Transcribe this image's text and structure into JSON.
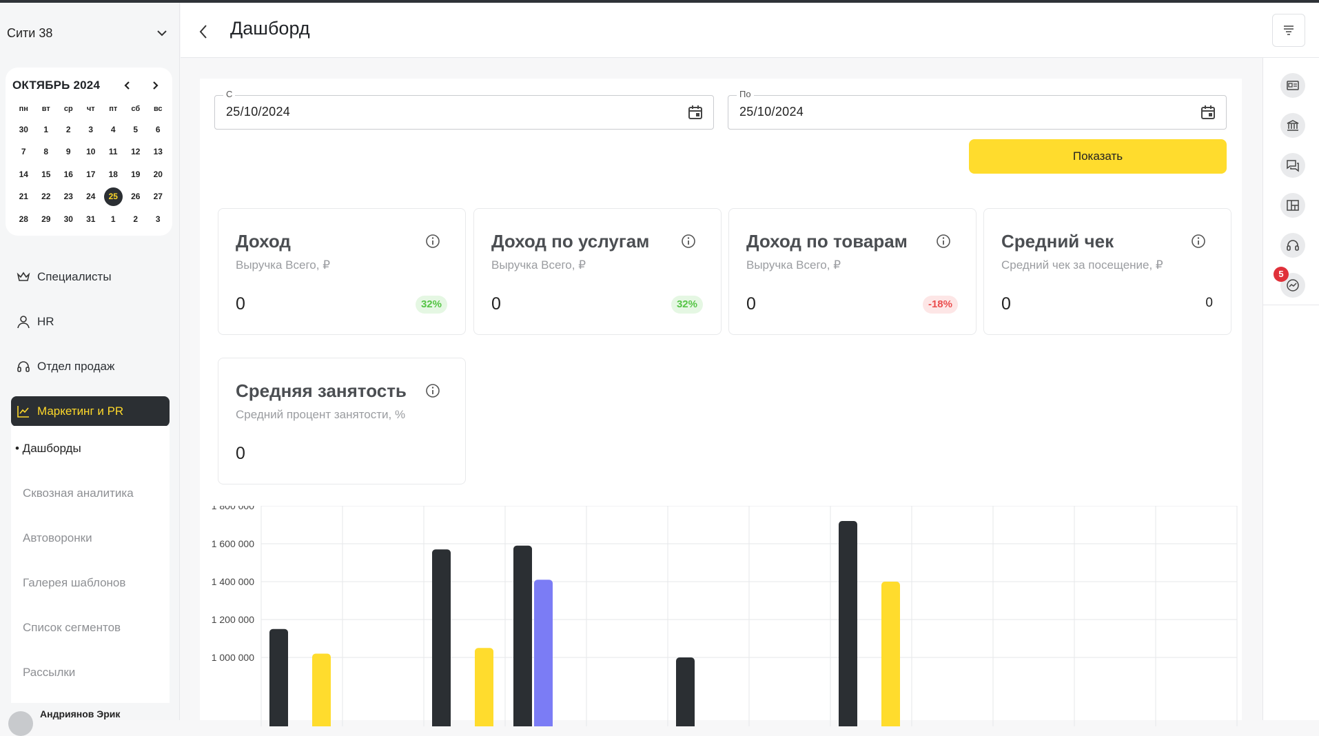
{
  "sidebar": {
    "city": "Сити 38",
    "calendar": {
      "title": "ОКТЯБРЬ 2024",
      "weekdays": [
        "пн",
        "вт",
        "ср",
        "чт",
        "пт",
        "сб",
        "вс"
      ],
      "days": [
        "30",
        "1",
        "2",
        "3",
        "4",
        "5",
        "6",
        "7",
        "8",
        "9",
        "10",
        "11",
        "12",
        "13",
        "14",
        "15",
        "16",
        "17",
        "18",
        "19",
        "20",
        "21",
        "22",
        "23",
        "24",
        "25",
        "26",
        "27",
        "28",
        "29",
        "30",
        "31",
        "1",
        "2",
        "3"
      ],
      "selected": "25"
    },
    "nav": [
      {
        "label": "Специалисты",
        "icon": "crown-icon"
      },
      {
        "label": "HR",
        "icon": "user-icon"
      },
      {
        "label": "Отдел продаж",
        "icon": "headset-icon"
      },
      {
        "label": "Маркетинг и PR",
        "icon": "chart-line-icon",
        "active": true
      }
    ],
    "subnav": [
      "• Дашборды",
      "Сквозная аналитика",
      "Автоворонки",
      "Галерея шаблонов",
      "Список сегментов",
      "Рассылки"
    ],
    "user_name": "Андриянов Эрик"
  },
  "header": {
    "title": "Дашборд"
  },
  "filters": {
    "from_label": "С",
    "from_value": "25/10/2024",
    "to_label": "По",
    "to_value": "25/10/2024",
    "show_button": "Показать"
  },
  "cards": [
    {
      "title": "Доход",
      "subtitle": "Выручка Всего, ₽",
      "value": "0",
      "delta": "32%",
      "trend": "up"
    },
    {
      "title": "Доход по услугам",
      "subtitle": "Выручка Всего, ₽",
      "value": "0",
      "delta": "32%",
      "trend": "up"
    },
    {
      "title": "Доход по товарам",
      "subtitle": "Выручка Всего, ₽",
      "value": "0",
      "delta": "-18%",
      "trend": "down"
    },
    {
      "title": "Средний чек",
      "subtitle": "Средний чек за посещение, ₽",
      "value": "0",
      "delta": "0",
      "trend": "none"
    },
    {
      "title": "Средняя занятость",
      "subtitle": "Средний процент занятости, %",
      "value": "0",
      "delta": "",
      "trend": "none"
    }
  ],
  "rail": {
    "badge": "5",
    "icons": [
      "id-card-icon",
      "bank-icon",
      "chat-icon",
      "board-icon",
      "headset-icon",
      "analytics-icon"
    ]
  },
  "colors": {
    "accent": "#ffdc2d",
    "dark": "#2b2f33",
    "purple": "#7b7cf5"
  },
  "chart_data": {
    "type": "bar",
    "y_ticks": [
      "1 800 000",
      "1 600 000",
      "1 400 000",
      "1 200 000",
      "1 000 000"
    ],
    "ylim": [
      1000000,
      1800000
    ],
    "groups": 12,
    "series": [
      {
        "color": "#2b2f33",
        "values": [
          1150000,
          null,
          1570000,
          1590000,
          null,
          1000000,
          null,
          1720000,
          null,
          null,
          null,
          null
        ]
      },
      {
        "color": "#ffdc2d",
        "values": [
          1020000,
          null,
          1050000,
          null,
          null,
          null,
          null,
          1400000,
          null,
          null,
          null,
          null
        ]
      },
      {
        "color": "#7b7cf5",
        "values": [
          null,
          null,
          null,
          1410000,
          null,
          null,
          null,
          null,
          null,
          null,
          null,
          null
        ]
      }
    ]
  }
}
